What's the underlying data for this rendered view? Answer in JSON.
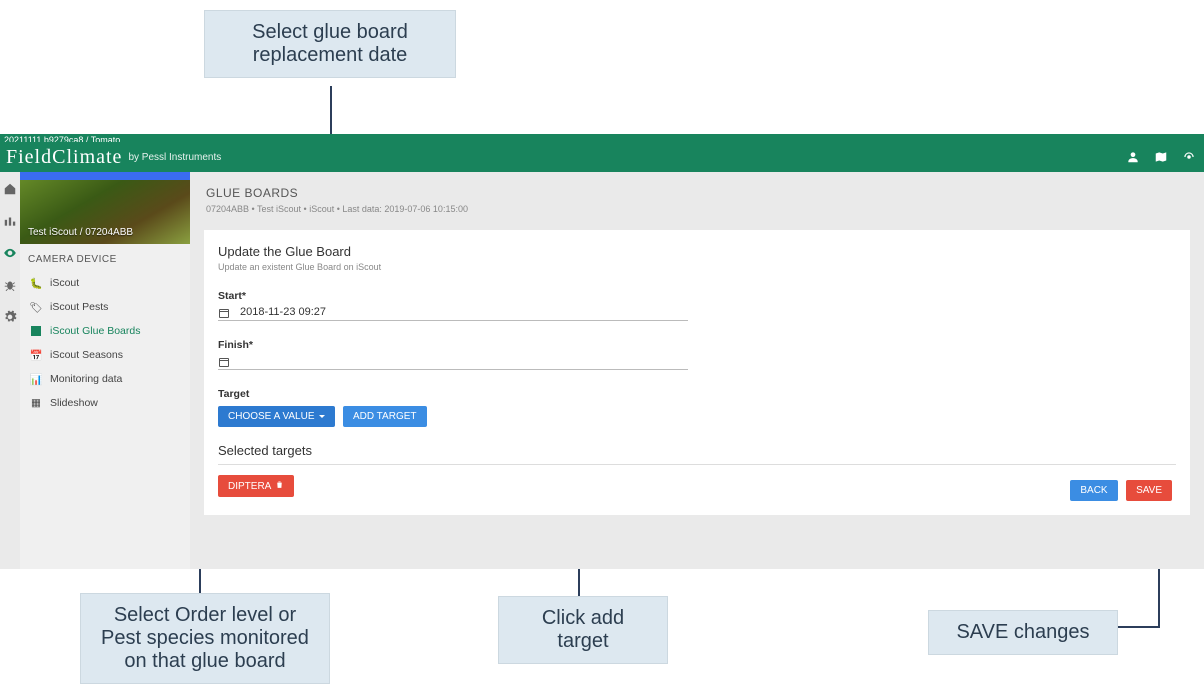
{
  "annotations": {
    "top": "Select glue board replacement date",
    "bottom_left": "Select Order level or Pest species monitored on that glue board",
    "bottom_mid": "Click add target",
    "bottom_right": "SAVE changes"
  },
  "tinybar": "20211111.b9279ca8 / Tomato",
  "brand": {
    "name": "FieldClimate",
    "by": "by Pessl Instruments"
  },
  "sidebar": {
    "crumb": "Test iScout / 07204ABB",
    "section": "CAMERA DEVICE",
    "items": [
      {
        "label": "iScout"
      },
      {
        "label": "iScout Pests"
      },
      {
        "label": "iScout Glue Boards"
      },
      {
        "label": "iScout Seasons"
      },
      {
        "label": "Monitoring data"
      },
      {
        "label": "Slideshow"
      }
    ]
  },
  "page": {
    "title": "GLUE BOARDS",
    "crumb": "07204ABB • Test iScout • iScout • Last data: 2019-07-06 10:15:00"
  },
  "form": {
    "heading": "Update the Glue Board",
    "sub": "Update an existent Glue Board on iScout",
    "start_label": "Start*",
    "start_value": "2018-11-23 09:27",
    "finish_label": "Finish*",
    "finish_value": "",
    "target_label": "Target",
    "choose_btn": "CHOOSE A VALUE",
    "add_btn": "ADD TARGET",
    "selected_title": "Selected targets",
    "selected_chip": "DIPTERA",
    "back_btn": "BACK",
    "save_btn": "SAVE"
  }
}
